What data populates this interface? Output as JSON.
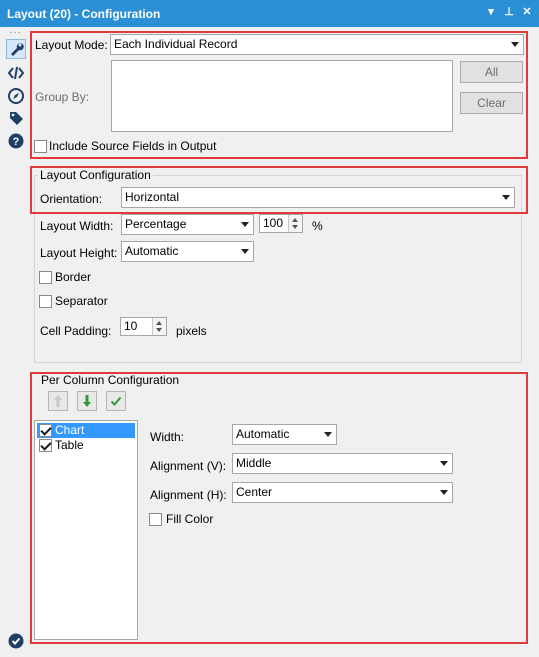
{
  "window": {
    "title": "Layout (20) - Configuration",
    "controls": [
      "▾",
      "⊥",
      "✕"
    ]
  },
  "sidebar": {
    "dots": "···",
    "icons": [
      "wrench-icon",
      "code-icon",
      "compass-icon",
      "tag-icon",
      "help-icon"
    ],
    "bottom_icon": "check-circle-icon"
  },
  "layout_mode": {
    "label": "Layout Mode:",
    "value": "Each Individual Record"
  },
  "group_by": {
    "label": "Group By:",
    "all_button": "All",
    "clear_button": "Clear"
  },
  "include_source": {
    "label": "Include Source Fields in Output",
    "checked": false
  },
  "layout_config": {
    "title": "Layout Configuration",
    "orientation": {
      "label": "Orientation:",
      "value": "Horizontal"
    },
    "width": {
      "label": "Layout Width:",
      "value": "Percentage",
      "number": "100",
      "unit": "%"
    },
    "height": {
      "label": "Layout Height:",
      "value": "Automatic"
    },
    "border": {
      "label": "Border",
      "checked": false
    },
    "separator": {
      "label": "Separator",
      "checked": false
    },
    "cell_padding": {
      "label": "Cell Padding:",
      "value": "10",
      "unit": "pixels"
    }
  },
  "per_column": {
    "title": "Per Column Configuration",
    "toolbar": [
      "move-up-icon",
      "move-down-icon",
      "checkmark-icon"
    ],
    "items": [
      {
        "label": "Chart",
        "checked": true,
        "selected": true
      },
      {
        "label": "Table",
        "checked": true,
        "selected": false
      }
    ],
    "width": {
      "label": "Width:",
      "value": "Automatic"
    },
    "align_v": {
      "label": "Alignment (V):",
      "value": "Middle"
    },
    "align_h": {
      "label": "Alignment (H):",
      "value": "Center"
    },
    "fill_color": {
      "label": "Fill Color",
      "checked": false
    }
  },
  "colors": {
    "titlebar": "#2b8fd6",
    "highlight": "#e0393e",
    "selection": "#3399ff"
  }
}
